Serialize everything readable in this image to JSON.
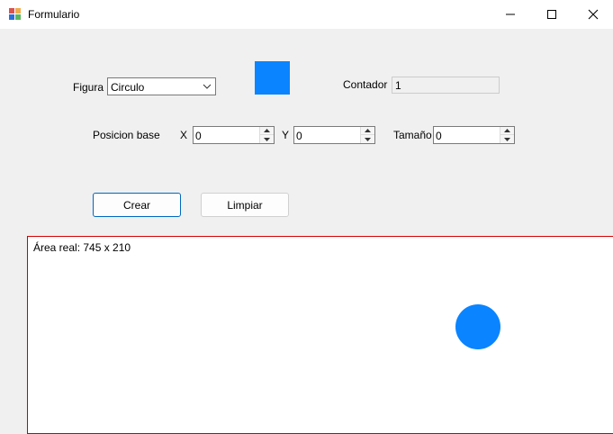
{
  "window": {
    "title": "Formulario",
    "icons": {
      "app": "form-app-icon",
      "minimize": "minimize-icon",
      "maximize": "maximize-icon",
      "close": "close-icon"
    }
  },
  "form": {
    "figura_label": "Figura",
    "figura_value": "Circulo",
    "contador_label": "Contador",
    "contador_value": "1",
    "posicion_label": "Posicion base",
    "x_label": "X",
    "x_value": "0",
    "y_label": "Y",
    "y_value": "0",
    "tamano_label": "Tamaño",
    "tamano_value": "0",
    "swatch_color": "#0a84ff"
  },
  "buttons": {
    "crear": "Crear",
    "limpiar": "Limpiar"
  },
  "canvas": {
    "info": "Área real: 745 x 210",
    "border_color": "#d00000",
    "shape_color": "#0a84ff"
  }
}
